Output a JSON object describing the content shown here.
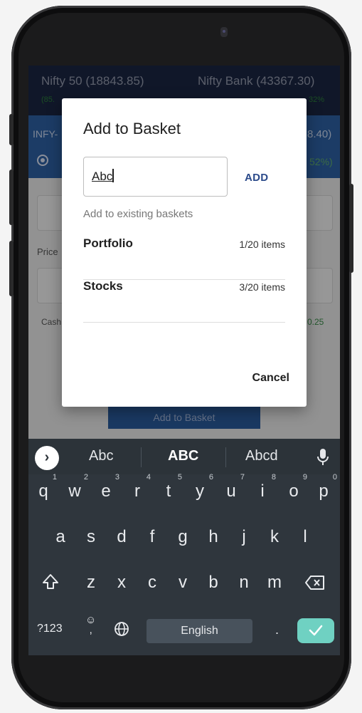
{
  "app": {
    "nifty50_label": "Nifty 50 (18843.85)",
    "nifty50_change": "(85.",
    "niftybank_label": "Nifty Bank (43367.30)",
    "niftybank_change": "32%",
    "stock_left": "INFY-",
    "stock_right": "8.40)",
    "stock_change_right": "52%)",
    "price_label": "Price",
    "cash_label": "Cash",
    "cash_value": "0.25",
    "add_to_basket_button": "Add to Basket"
  },
  "dialog": {
    "title": "Add to Basket",
    "input_value": "Abc",
    "add_label": "ADD",
    "existing_label": "Add to existing baskets",
    "baskets": [
      {
        "name": "Portfolio",
        "count": "1/20 items"
      },
      {
        "name": "Stocks",
        "count": "3/20 items"
      }
    ],
    "cancel_label": "Cancel"
  },
  "keyboard": {
    "suggestions": [
      "Abc",
      "ABC",
      "Abcd"
    ],
    "row1": [
      {
        "k": "q",
        "n": "1"
      },
      {
        "k": "w",
        "n": "2"
      },
      {
        "k": "e",
        "n": "3"
      },
      {
        "k": "r",
        "n": "4"
      },
      {
        "k": "t",
        "n": "5"
      },
      {
        "k": "y",
        "n": "6"
      },
      {
        "k": "u",
        "n": "7"
      },
      {
        "k": "i",
        "n": "8"
      },
      {
        "k": "o",
        "n": "9"
      },
      {
        "k": "p",
        "n": "0"
      }
    ],
    "row2": [
      "a",
      "s",
      "d",
      "f",
      "g",
      "h",
      "j",
      "k",
      "l"
    ],
    "row3": [
      "z",
      "x",
      "c",
      "v",
      "b",
      "n",
      "m"
    ],
    "symbols_label": "?123",
    "space_label": "English",
    "period_label": "."
  },
  "colors": {
    "accent": "#2b4a8a",
    "keyboard_bg": "#2f363d",
    "enter_key": "#6fd1c2"
  }
}
